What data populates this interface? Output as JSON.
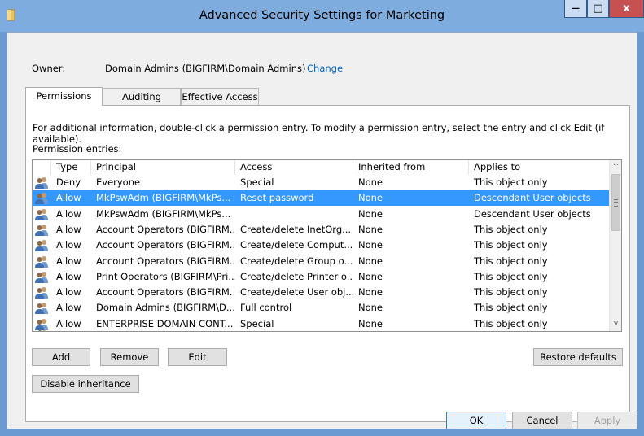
{
  "window": {
    "title": "Advanced Security Settings for Marketing",
    "minimize_glyph": "—",
    "maximize_glyph": "□",
    "close_glyph": "x"
  },
  "owner": {
    "label": "Owner:",
    "value": "Domain Admins (BIGFIRM\\Domain Admins)",
    "change_link": "Change"
  },
  "tabs": [
    {
      "label": "Permissions",
      "active": true
    },
    {
      "label": "Auditing",
      "active": false
    },
    {
      "label": "Effective Access",
      "active": false
    }
  ],
  "permissions": {
    "info_text": "For additional information, double-click a permission entry. To modify a permission entry, select the entry and click Edit (if available).",
    "entries_label": "Permission entries:",
    "columns": [
      "Type",
      "Principal",
      "Access",
      "Inherited from",
      "Applies to"
    ],
    "rows": [
      {
        "type": "Deny",
        "principal": "Everyone",
        "access": "Special",
        "inherited": "None",
        "applies": "This object only",
        "selected": false
      },
      {
        "type": "Allow",
        "principal": "MkPswAdm (BIGFIRM\\MkPs...",
        "access": "Reset password",
        "inherited": "None",
        "applies": "Descendant User objects",
        "selected": true
      },
      {
        "type": "Allow",
        "principal": "MkPswAdm (BIGFIRM\\MkPs...",
        "access": "",
        "inherited": "None",
        "applies": "Descendant User objects",
        "selected": false
      },
      {
        "type": "Allow",
        "principal": "Account Operators (BIGFIRM...",
        "access": "Create/delete InetOrg...",
        "inherited": "None",
        "applies": "This object only",
        "selected": false
      },
      {
        "type": "Allow",
        "principal": "Account Operators (BIGFIRM...",
        "access": "Create/delete Comput...",
        "inherited": "None",
        "applies": "This object only",
        "selected": false
      },
      {
        "type": "Allow",
        "principal": "Account Operators (BIGFIRM...",
        "access": "Create/delete Group o...",
        "inherited": "None",
        "applies": "This object only",
        "selected": false
      },
      {
        "type": "Allow",
        "principal": "Print Operators (BIGFIRM\\Pri...",
        "access": "Create/delete Printer o...",
        "inherited": "None",
        "applies": "This object only",
        "selected": false
      },
      {
        "type": "Allow",
        "principal": "Account Operators (BIGFIRM...",
        "access": "Create/delete User obj...",
        "inherited": "None",
        "applies": "This object only",
        "selected": false
      },
      {
        "type": "Allow",
        "principal": "Domain Admins (BIGFIRM\\D...",
        "access": "Full control",
        "inherited": "None",
        "applies": "This object only",
        "selected": false
      },
      {
        "type": "Allow",
        "principal": "ENTERPRISE DOMAIN CONT...",
        "access": "Special",
        "inherited": "None",
        "applies": "This object only",
        "selected": false
      }
    ],
    "scroll_up_glyph": "^",
    "scroll_down_glyph": "v",
    "buttons": {
      "add": "Add",
      "remove": "Remove",
      "edit": "Edit",
      "restore_defaults": "Restore defaults",
      "disable_inheritance": "Disable inheritance"
    }
  },
  "footer": {
    "ok": "OK",
    "cancel": "Cancel",
    "apply": "Apply"
  },
  "colors": {
    "selection": "#3399ff",
    "link": "#0066cc",
    "titlebar": "#7eacde",
    "close_button": "#c75050"
  },
  "icons": {
    "title": "folder-icon",
    "row": "users-group-icon"
  }
}
